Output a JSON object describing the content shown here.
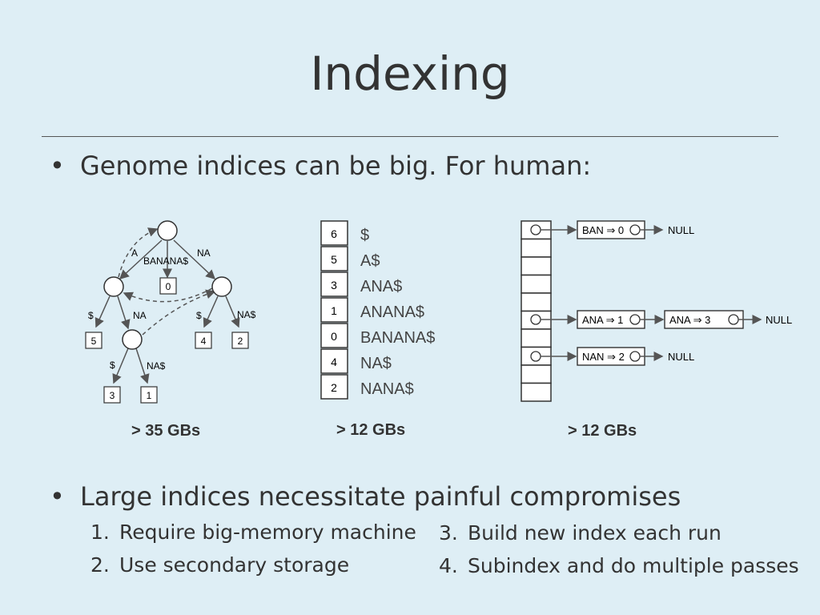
{
  "slide": {
    "title": "Indexing",
    "bullet1": "Genome indices can be big.  For human:",
    "bullet2": "Large indices necessitate painful compromises",
    "compromises": [
      {
        "num": "1.",
        "text": "Require big-memory machine"
      },
      {
        "num": "2.",
        "text": "Use secondary storage"
      },
      {
        "num": "3.",
        "text": "Build new index each run"
      },
      {
        "num": "4.",
        "text": "Subindex and do multiple passes"
      }
    ]
  },
  "suffix_tree": {
    "size": "> 35 GBs",
    "edge_labels": [
      "A",
      "BANANA$",
      "NA",
      "$",
      "NA",
      "$",
      "NA$",
      "$",
      "NA$"
    ],
    "leaves": [
      "0",
      "5",
      "4",
      "2",
      "3",
      "1"
    ]
  },
  "suffix_array": {
    "size": "> 12 GBs",
    "indices": [
      "6",
      "5",
      "3",
      "1",
      "0",
      "4",
      "2"
    ],
    "suffixes": [
      "$",
      "A$",
      "ANA$",
      "ANANA$",
      "BANANA$",
      "NA$",
      "NANA$"
    ]
  },
  "hash_table": {
    "size": "> 12 GBs",
    "entries": [
      {
        "label": "BAN ⇒ 0",
        "next": "NULL"
      },
      {
        "label": "ANA ⇒ 1",
        "next": ""
      },
      {
        "label": "ANA ⇒ 3",
        "next": "NULL"
      },
      {
        "label": "NAN ⇒ 2",
        "next": "NULL"
      }
    ]
  },
  "colors": {
    "background": "#deeef5",
    "line": "#555555",
    "text": "#333333"
  }
}
